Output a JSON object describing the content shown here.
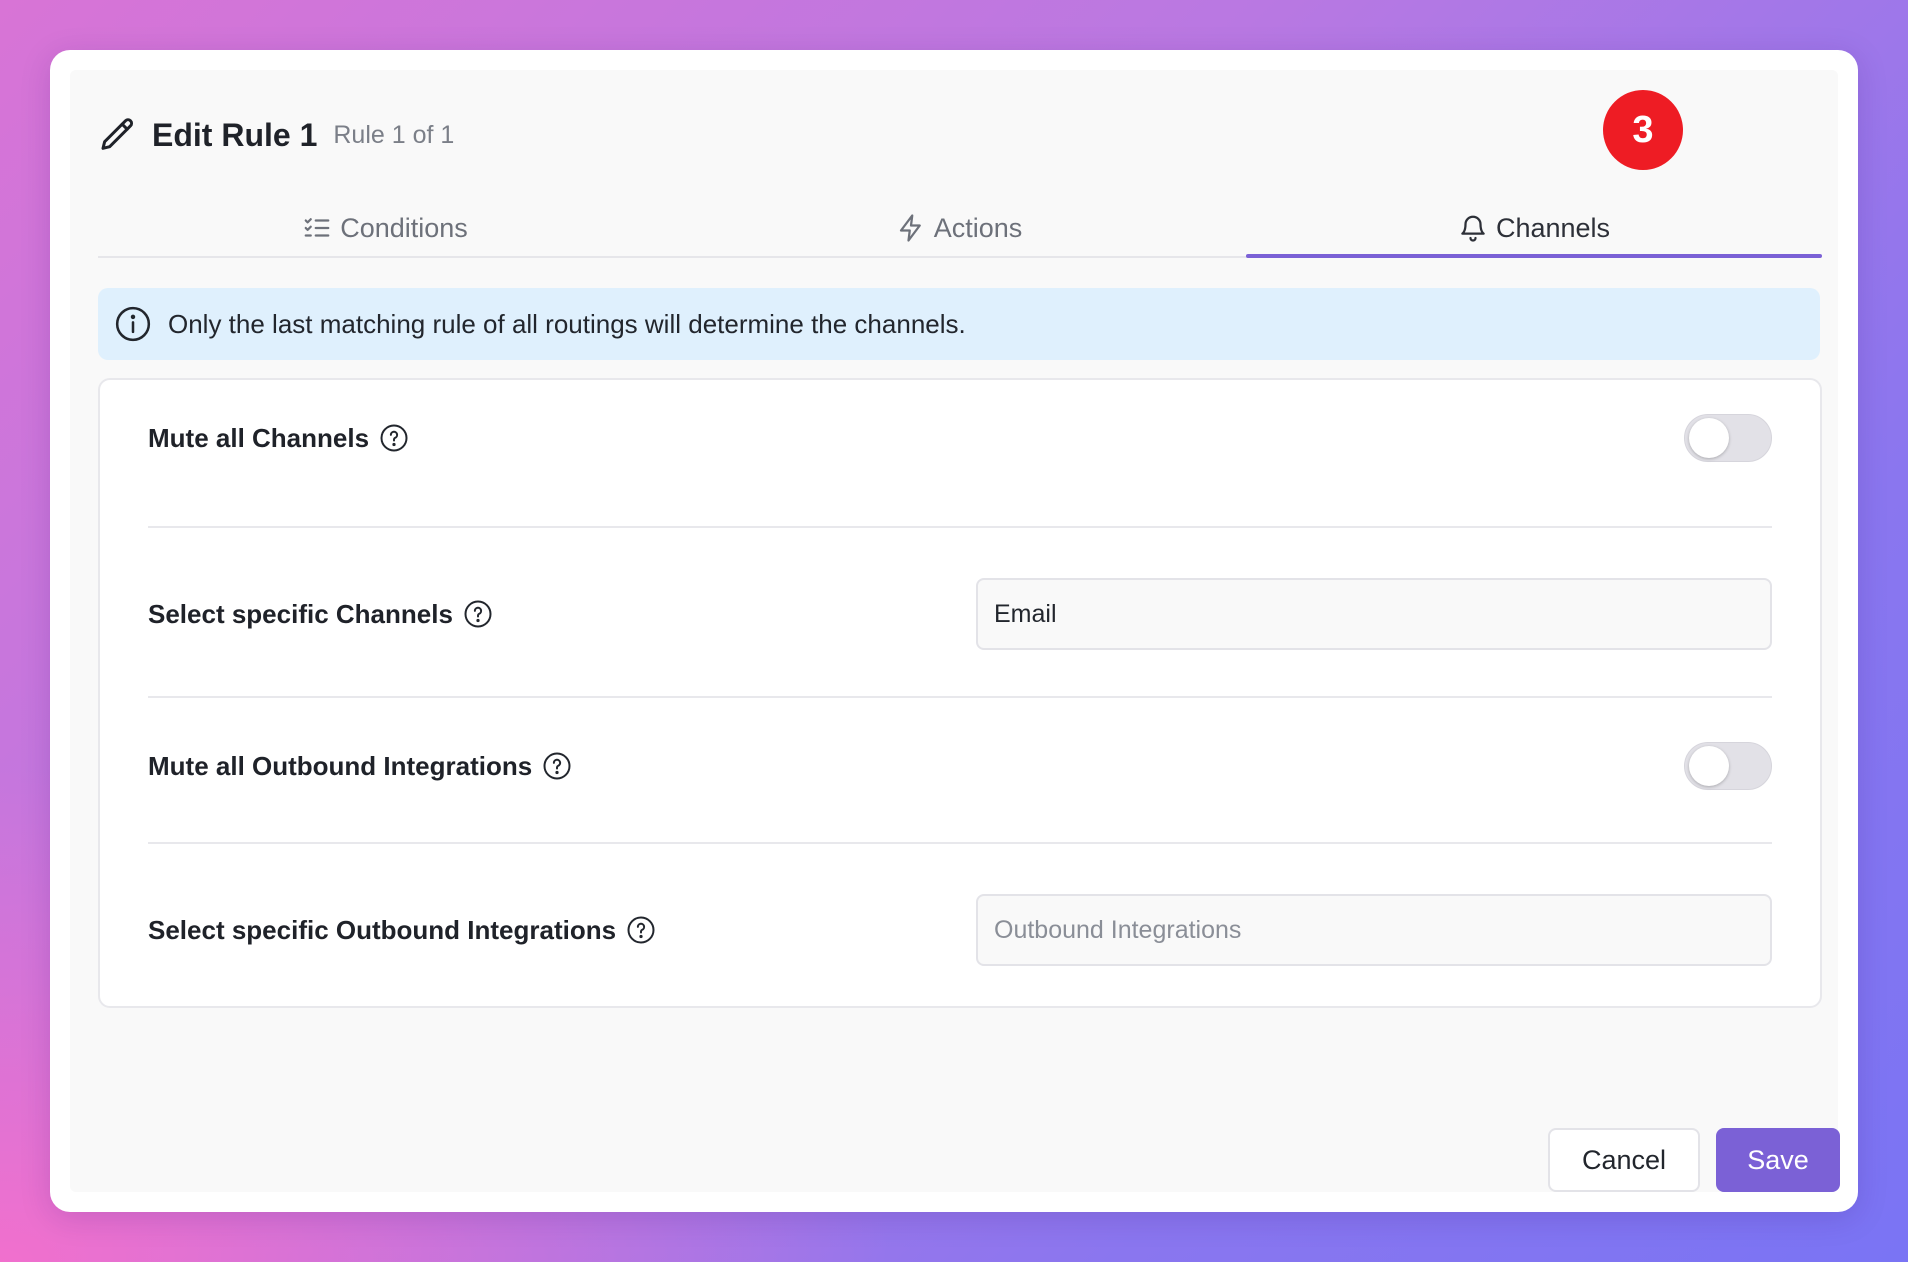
{
  "header": {
    "title": "Edit Rule 1",
    "subtitle": "Rule 1 of 1",
    "icon": "pencil-icon"
  },
  "tabs": [
    {
      "label": "Conditions",
      "icon": "checklist-icon",
      "active": false
    },
    {
      "label": "Actions",
      "icon": "lightning-icon",
      "active": false
    },
    {
      "label": "Channels",
      "icon": "bell-icon",
      "active": true
    }
  ],
  "step_badge": "3",
  "info": {
    "text": "Only the last matching rule of all routings will determine the channels.",
    "icon": "info-icon"
  },
  "settings": {
    "mute_channels": {
      "label": "Mute all Channels",
      "enabled": false
    },
    "specific_channels": {
      "label": "Select specific Channels",
      "value": "Email"
    },
    "mute_integrations": {
      "label": "Mute all Outbound Integrations",
      "enabled": false
    },
    "specific_integrations": {
      "label": "Select specific Outbound Integrations",
      "value": "",
      "placeholder": "Outbound Integrations"
    }
  },
  "footer": {
    "cancel_label": "Cancel",
    "save_label": "Save"
  },
  "colors": {
    "accent": "#7b61d6",
    "badge": "#ee1c24",
    "info_bg": "#dff0fd"
  }
}
